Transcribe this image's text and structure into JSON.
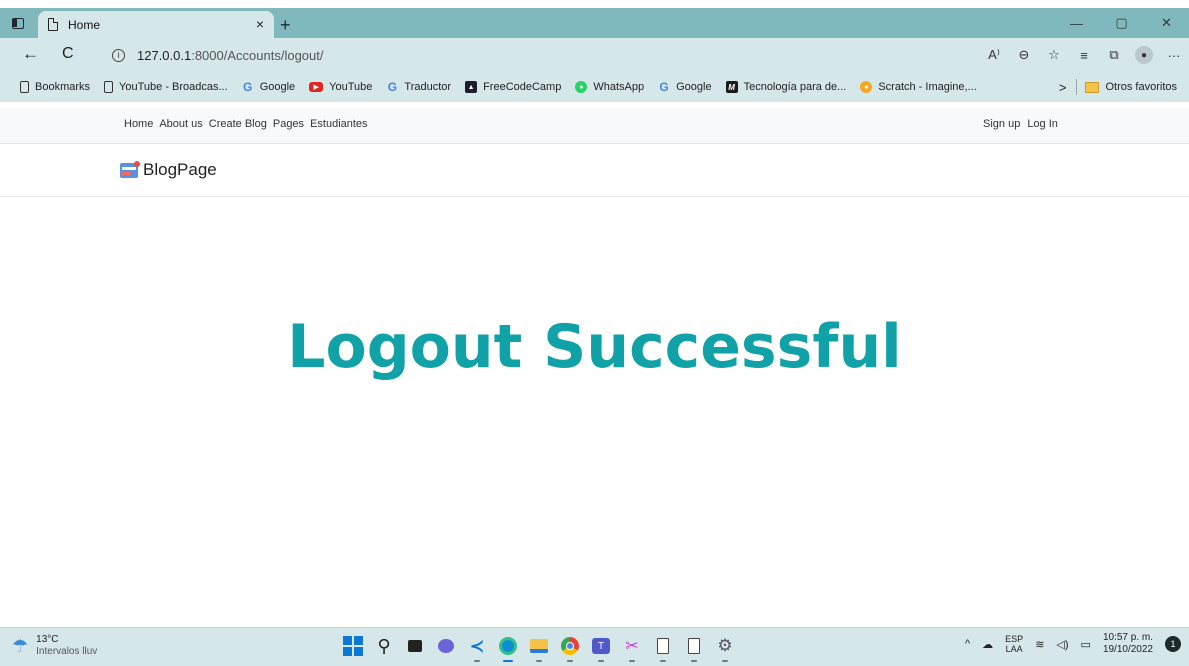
{
  "browser": {
    "tab": {
      "title": "Home",
      "close": "×"
    },
    "new_tab": "+",
    "window_controls": {
      "minimize": "—",
      "maximize": "▢",
      "close": "✕"
    },
    "nav": {
      "back": "←",
      "refresh": "C"
    },
    "url": {
      "host": "127.0.0.1",
      "path": ":8000/Accounts/logout/"
    },
    "toolbar_icons": [
      "read-aloud-icon",
      "zoom-icon",
      "favorite-icon",
      "favorites-list-icon",
      "collections-icon",
      "profile-icon",
      "more-icon"
    ],
    "toolbar_labels": {
      "read": "A⁾",
      "zoom": "⊖",
      "fav": "☆",
      "favlist": "≡",
      "collections": "⧉",
      "more": "···"
    }
  },
  "bookmarks": {
    "items": [
      {
        "label": "Bookmarks",
        "icon": "page"
      },
      {
        "label": "YouTube - Broadcas...",
        "icon": "page"
      },
      {
        "label": "Google",
        "icon": "g"
      },
      {
        "label": "YouTube",
        "icon": "yt"
      },
      {
        "label": "Traductor",
        "icon": "g"
      },
      {
        "label": "FreeCodeCamp",
        "icon": "fcc"
      },
      {
        "label": "WhatsApp",
        "icon": "wa"
      },
      {
        "label": "Google",
        "icon": "g"
      },
      {
        "label": "Tecnología para de...",
        "icon": "m"
      },
      {
        "label": "Scratch - Imagine,...",
        "icon": "sc"
      }
    ],
    "overflow": ">",
    "other": "Otros favoritos"
  },
  "site": {
    "nav_links": [
      "Home",
      "About us",
      "Create Blog",
      "Pages",
      "Estudiantes"
    ],
    "auth_links": [
      "Sign up",
      "Log In"
    ],
    "brand": "BlogPage",
    "headline": "Logout Successful"
  },
  "taskbar": {
    "weather": {
      "temp": "13°C",
      "condition": "Intervalos lluv"
    },
    "apps": [
      "start",
      "search",
      "task-view",
      "chat",
      "vscode",
      "edge",
      "file-explorer",
      "chrome",
      "teams",
      "snipping-tool",
      "notepad",
      "notepad",
      "settings"
    ],
    "tray": {
      "chevron": "^",
      "lang_top": "ESP",
      "lang_bottom": "LAA",
      "time": "10:57 p. m.",
      "date": "19/10/2022",
      "notifications": "1"
    }
  },
  "colors": {
    "accent": "#10a2a6",
    "titlebar": "#7fb8bd",
    "chrome_bg": "#d6e7e9"
  }
}
